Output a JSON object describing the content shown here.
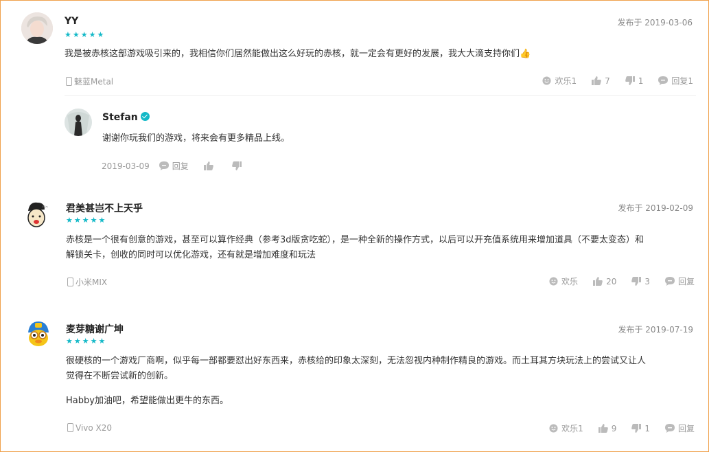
{
  "reviews": [
    {
      "user": "YY",
      "stars": "★★★★★",
      "date": "发布于 2019-03-06",
      "text": "我是被赤核这部游戏吸引来的，我相信你们居然能做出这么好玩的赤核，就一定会有更好的发展，我大大滴支持你们👍",
      "device": "魅蓝Metal",
      "funny": "欢乐1",
      "likes": "7",
      "dislikes": "1",
      "reply": "回复1",
      "dev_reply": {
        "user": "Stefan",
        "text": "谢谢你玩我们的游戏，将来会有更多精品上线。",
        "date": "2019-03-09",
        "reply": "回复"
      }
    },
    {
      "user": "君美甚岂不上天乎",
      "stars": "★★★★★",
      "date": "发布于 2019-02-09",
      "text_line1": "赤核是一个很有创意的游戏，甚至可以算作经典（参考3d版贪吃蛇），是一种全新的操作方式，以后可以开充值系统用来增加道具（不要太变态）和",
      "text_line2": "解锁关卡，创收的同时可以优化游戏，还有就是增加难度和玩法",
      "device": "小米MIX",
      "funny": "欢乐",
      "likes": "20",
      "dislikes": "3",
      "reply": "回复"
    },
    {
      "user": "麦芽糖谢广坤",
      "stars": "★★★★★",
      "date": "发布于 2019-07-19",
      "text_line1": "很硬核的一个游戏厂商啊，似乎每一部都要怼出好东西来，赤核给的印象太深刻，无法忽视内种制作精良的游戏。而土耳其方块玩法上的尝试又让人",
      "text_line2": "觉得在不断尝试新的创新。",
      "text_line3": "Habby加油吧，希望能做出更牛的东西。",
      "device": "Vivo X20",
      "funny": "欢乐1",
      "likes": "9",
      "dislikes": "1",
      "reply": "回复"
    }
  ],
  "colors": {
    "accent": "#14b9c8",
    "border": "#f0a04b",
    "muted": "#999999"
  }
}
